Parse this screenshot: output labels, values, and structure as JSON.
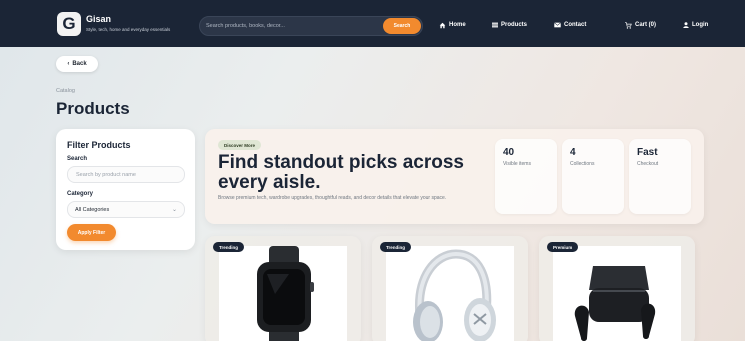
{
  "header": {
    "brand_letter": "G",
    "brand_name": "Gisan",
    "brand_tagline": "Style, tech, home and everyday essentials",
    "search_placeholder": "Search products, books, decor...",
    "search_button": "Search",
    "nav": [
      {
        "label": "Home",
        "icon": "home-icon"
      },
      {
        "label": "Products",
        "icon": "list-icon"
      },
      {
        "label": "Contact",
        "icon": "mail-icon"
      },
      {
        "label": "Cart (0)",
        "icon": "cart-icon"
      },
      {
        "label": "Login",
        "icon": "user-icon"
      }
    ]
  },
  "page": {
    "back_label": "Back",
    "breadcrumb": "Catalog",
    "title": "Products"
  },
  "filter": {
    "title": "Filter Products",
    "search_label": "Search",
    "search_placeholder": "Search by product name",
    "category_label": "Category",
    "category_value": "All Categories",
    "apply_label": "Apply Filter"
  },
  "hero": {
    "badge": "Discover More",
    "title": "Find standout picks across every aisle.",
    "description": "Browse premium tech, wardrobe upgrades, thoughtful reads, and decor details that elevate your space.",
    "stats": [
      {
        "value": "40",
        "label": "Visible items"
      },
      {
        "value": "4",
        "label": "Collections"
      },
      {
        "value": "Fast",
        "label": "Checkout"
      }
    ]
  },
  "products": [
    {
      "badge": "Trending",
      "image": "smartwatch"
    },
    {
      "badge": "Trending",
      "image": "headphones"
    },
    {
      "badge": "Premium",
      "image": "earbuds"
    }
  ],
  "colors": {
    "navbar": "#1b2536",
    "accent": "#f28a2e"
  }
}
